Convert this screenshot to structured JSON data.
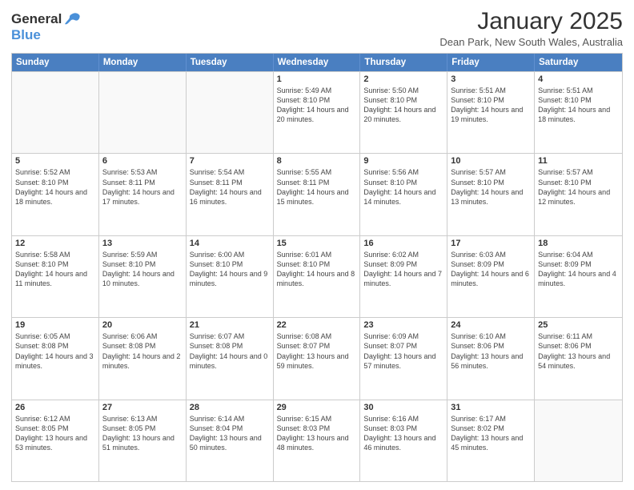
{
  "header": {
    "logo_general": "General",
    "logo_blue": "Blue",
    "title": "January 2025",
    "location": "Dean Park, New South Wales, Australia"
  },
  "days_of_week": [
    "Sunday",
    "Monday",
    "Tuesday",
    "Wednesday",
    "Thursday",
    "Friday",
    "Saturday"
  ],
  "weeks": [
    [
      {
        "day": "",
        "info": ""
      },
      {
        "day": "",
        "info": ""
      },
      {
        "day": "",
        "info": ""
      },
      {
        "day": "1",
        "info": "Sunrise: 5:49 AM\nSunset: 8:10 PM\nDaylight: 14 hours\nand 20 minutes."
      },
      {
        "day": "2",
        "info": "Sunrise: 5:50 AM\nSunset: 8:10 PM\nDaylight: 14 hours\nand 20 minutes."
      },
      {
        "day": "3",
        "info": "Sunrise: 5:51 AM\nSunset: 8:10 PM\nDaylight: 14 hours\nand 19 minutes."
      },
      {
        "day": "4",
        "info": "Sunrise: 5:51 AM\nSunset: 8:10 PM\nDaylight: 14 hours\nand 18 minutes."
      }
    ],
    [
      {
        "day": "5",
        "info": "Sunrise: 5:52 AM\nSunset: 8:10 PM\nDaylight: 14 hours\nand 18 minutes."
      },
      {
        "day": "6",
        "info": "Sunrise: 5:53 AM\nSunset: 8:11 PM\nDaylight: 14 hours\nand 17 minutes."
      },
      {
        "day": "7",
        "info": "Sunrise: 5:54 AM\nSunset: 8:11 PM\nDaylight: 14 hours\nand 16 minutes."
      },
      {
        "day": "8",
        "info": "Sunrise: 5:55 AM\nSunset: 8:11 PM\nDaylight: 14 hours\nand 15 minutes."
      },
      {
        "day": "9",
        "info": "Sunrise: 5:56 AM\nSunset: 8:10 PM\nDaylight: 14 hours\nand 14 minutes."
      },
      {
        "day": "10",
        "info": "Sunrise: 5:57 AM\nSunset: 8:10 PM\nDaylight: 14 hours\nand 13 minutes."
      },
      {
        "day": "11",
        "info": "Sunrise: 5:57 AM\nSunset: 8:10 PM\nDaylight: 14 hours\nand 12 minutes."
      }
    ],
    [
      {
        "day": "12",
        "info": "Sunrise: 5:58 AM\nSunset: 8:10 PM\nDaylight: 14 hours\nand 11 minutes."
      },
      {
        "day": "13",
        "info": "Sunrise: 5:59 AM\nSunset: 8:10 PM\nDaylight: 14 hours\nand 10 minutes."
      },
      {
        "day": "14",
        "info": "Sunrise: 6:00 AM\nSunset: 8:10 PM\nDaylight: 14 hours\nand 9 minutes."
      },
      {
        "day": "15",
        "info": "Sunrise: 6:01 AM\nSunset: 8:10 PM\nDaylight: 14 hours\nand 8 minutes."
      },
      {
        "day": "16",
        "info": "Sunrise: 6:02 AM\nSunset: 8:09 PM\nDaylight: 14 hours\nand 7 minutes."
      },
      {
        "day": "17",
        "info": "Sunrise: 6:03 AM\nSunset: 8:09 PM\nDaylight: 14 hours\nand 6 minutes."
      },
      {
        "day": "18",
        "info": "Sunrise: 6:04 AM\nSunset: 8:09 PM\nDaylight: 14 hours\nand 4 minutes."
      }
    ],
    [
      {
        "day": "19",
        "info": "Sunrise: 6:05 AM\nSunset: 8:08 PM\nDaylight: 14 hours\nand 3 minutes."
      },
      {
        "day": "20",
        "info": "Sunrise: 6:06 AM\nSunset: 8:08 PM\nDaylight: 14 hours\nand 2 minutes."
      },
      {
        "day": "21",
        "info": "Sunrise: 6:07 AM\nSunset: 8:08 PM\nDaylight: 14 hours\nand 0 minutes."
      },
      {
        "day": "22",
        "info": "Sunrise: 6:08 AM\nSunset: 8:07 PM\nDaylight: 13 hours\nand 59 minutes."
      },
      {
        "day": "23",
        "info": "Sunrise: 6:09 AM\nSunset: 8:07 PM\nDaylight: 13 hours\nand 57 minutes."
      },
      {
        "day": "24",
        "info": "Sunrise: 6:10 AM\nSunset: 8:06 PM\nDaylight: 13 hours\nand 56 minutes."
      },
      {
        "day": "25",
        "info": "Sunrise: 6:11 AM\nSunset: 8:06 PM\nDaylight: 13 hours\nand 54 minutes."
      }
    ],
    [
      {
        "day": "26",
        "info": "Sunrise: 6:12 AM\nSunset: 8:05 PM\nDaylight: 13 hours\nand 53 minutes."
      },
      {
        "day": "27",
        "info": "Sunrise: 6:13 AM\nSunset: 8:05 PM\nDaylight: 13 hours\nand 51 minutes."
      },
      {
        "day": "28",
        "info": "Sunrise: 6:14 AM\nSunset: 8:04 PM\nDaylight: 13 hours\nand 50 minutes."
      },
      {
        "day": "29",
        "info": "Sunrise: 6:15 AM\nSunset: 8:03 PM\nDaylight: 13 hours\nand 48 minutes."
      },
      {
        "day": "30",
        "info": "Sunrise: 6:16 AM\nSunset: 8:03 PM\nDaylight: 13 hours\nand 46 minutes."
      },
      {
        "day": "31",
        "info": "Sunrise: 6:17 AM\nSunset: 8:02 PM\nDaylight: 13 hours\nand 45 minutes."
      },
      {
        "day": "",
        "info": ""
      }
    ]
  ]
}
